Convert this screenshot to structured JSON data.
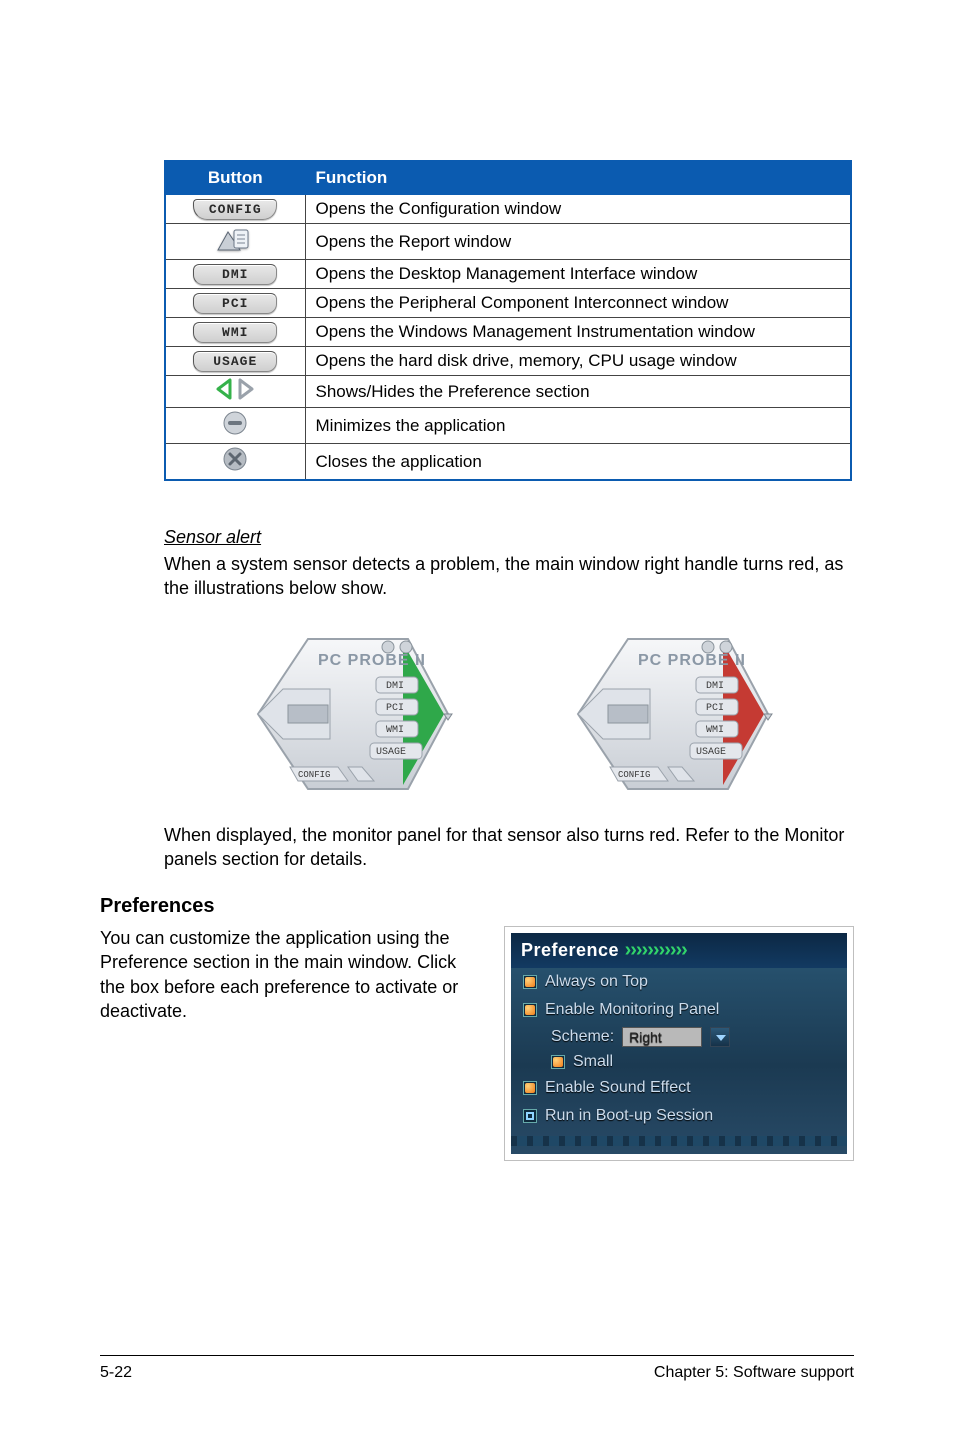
{
  "table": {
    "headers": {
      "button": "Button",
      "function": "Function"
    },
    "rows": [
      {
        "icon": "config-chip",
        "label": "CONFIG",
        "fn": "Opens the Configuration window"
      },
      {
        "icon": "report-icon",
        "label": "",
        "fn": "Opens the Report window"
      },
      {
        "icon": "dmi-chip",
        "label": "DMI",
        "fn": "Opens the Desktop Management Interface window"
      },
      {
        "icon": "pci-chip",
        "label": "PCI",
        "fn": "Opens the Peripheral Component Interconnect window"
      },
      {
        "icon": "wmi-chip",
        "label": "WMI",
        "fn": "Opens the Windows Management Instrumentation window"
      },
      {
        "icon": "usage-chip",
        "label": "USAGE",
        "fn": "Opens the hard disk drive, memory, CPU usage window"
      },
      {
        "icon": "pref-arrows-icon",
        "label": "",
        "fn": "Shows/Hides the Preference section"
      },
      {
        "icon": "minimize-icon",
        "label": "",
        "fn": "Minimizes the application"
      },
      {
        "icon": "close-icon",
        "label": "",
        "fn": "Closes the application"
      }
    ]
  },
  "sensor": {
    "heading": "Sensor alert",
    "para": "When a system sensor detects a problem, the main window right handle turns red, as the illustrations below show.",
    "after": "When displayed, the monitor panel for that sensor also turns red. Refer to the Monitor panels section for details.",
    "widget": {
      "title": "PC PROBE II",
      "labels": {
        "dmi": "DMI",
        "pci": "PCI",
        "wmi": "WMI",
        "usage": "USAGE",
        "config": "CONFIG"
      }
    }
  },
  "preferences": {
    "heading": "Preferences",
    "para": "You can customize the application using the Preference section in the main window. Click the box before each preference to activate or deactivate.",
    "panel": {
      "title": "Preference",
      "items": {
        "always_on_top": "Always on Top",
        "enable_monitoring": "Enable Monitoring Panel",
        "scheme_label": "Scheme:",
        "scheme_value": "Right",
        "small": "Small",
        "enable_sound": "Enable Sound Effect",
        "run_boot": "Run in Boot-up Session"
      }
    }
  },
  "footer": {
    "left": "5-22",
    "right": "Chapter 5: Software support"
  }
}
